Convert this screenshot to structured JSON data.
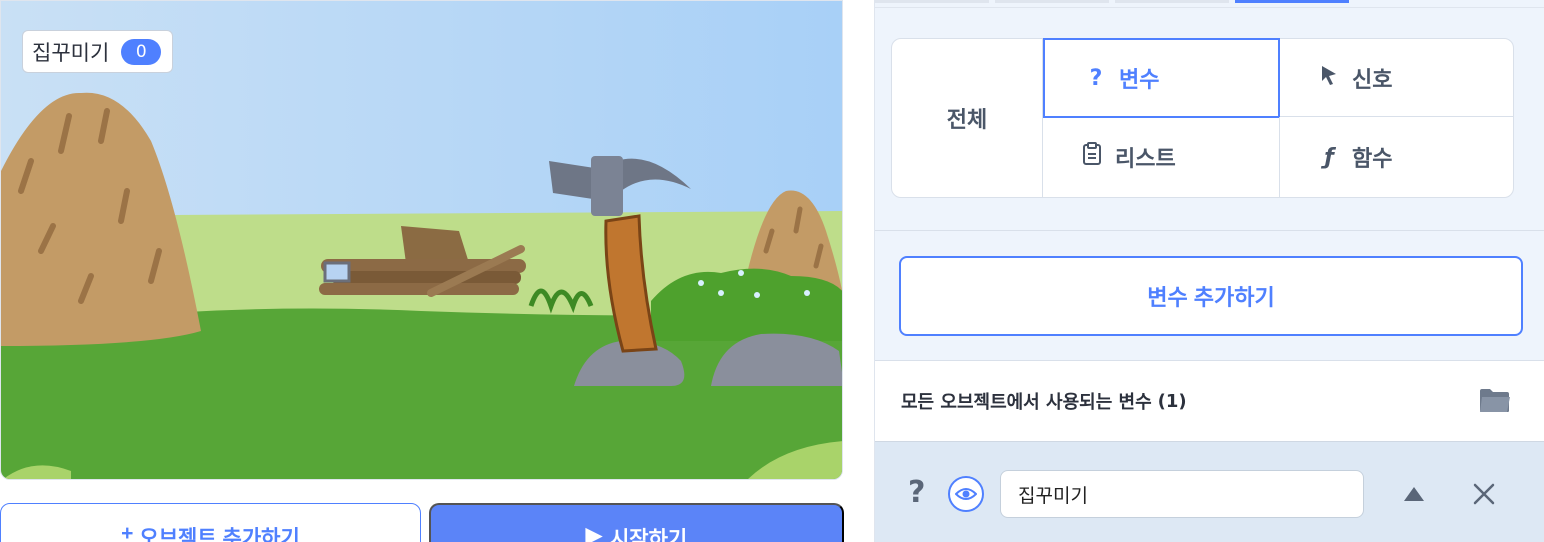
{
  "stage": {
    "variable_monitor": {
      "name": "집꾸미기",
      "value": "0"
    },
    "add_object_label": "오브젝트 추가하기",
    "start_label": "시작하기"
  },
  "categories": {
    "all": "전체",
    "variable": "변수",
    "signal": "신호",
    "list": "리스트",
    "function": "함수"
  },
  "add_variable_label": "변수 추가하기",
  "section": {
    "title": "모든 오브젝트에서 사용되는 변수",
    "count": "(1)"
  },
  "variable_item": {
    "name": "집꾸미기",
    "type_symbol": "?"
  },
  "colors": {
    "accent": "#4f80ff",
    "panel_bg": "#eef4fc",
    "row_bg": "#dde8f4"
  }
}
